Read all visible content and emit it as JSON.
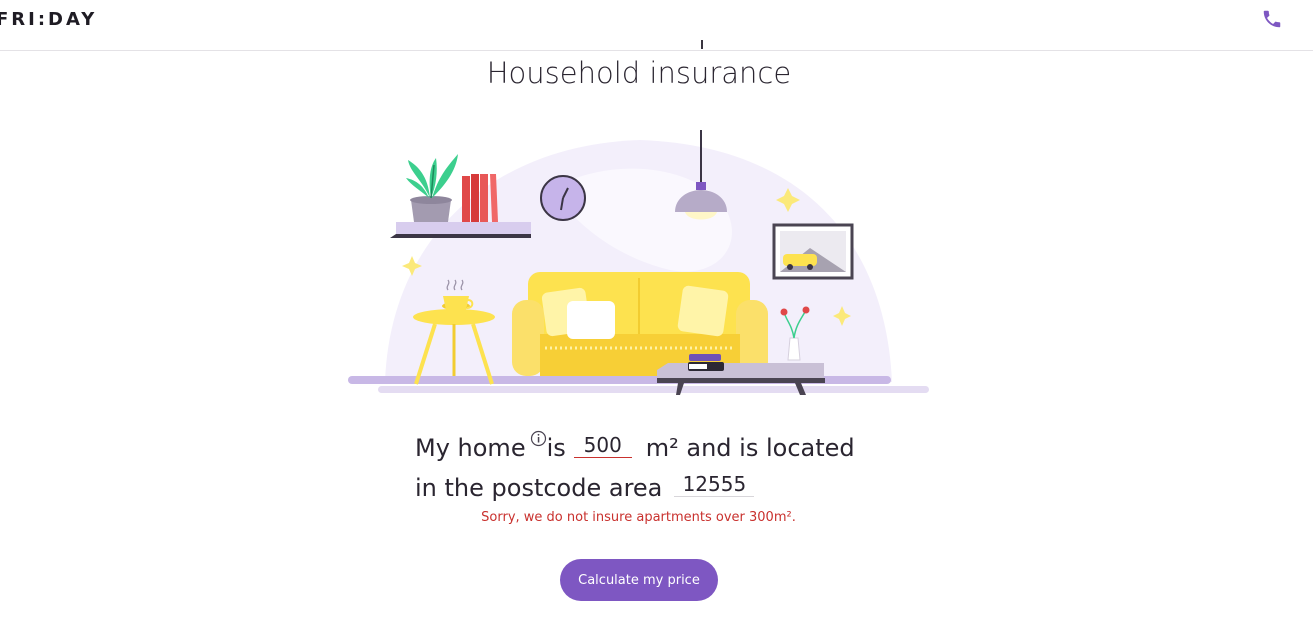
{
  "header": {
    "logo": "FRI:DAY",
    "phone_icon": "phone-icon"
  },
  "main": {
    "title": "Household insurance",
    "sentence": {
      "part1": "My home",
      "part2": "is",
      "part3": "m² and is located",
      "part4": "in the postcode area"
    },
    "area_value": "500",
    "postcode_value": "12555",
    "error": "Sorry, we do not insure apartments over 300m².",
    "cta_label": "Calculate my price"
  },
  "colors": {
    "accent": "#7e57c2",
    "error": "#c9312e",
    "sofa": "#fde24f",
    "lavender": "#c8b8e6"
  },
  "icons": [
    "phone-icon",
    "info-icon"
  ]
}
